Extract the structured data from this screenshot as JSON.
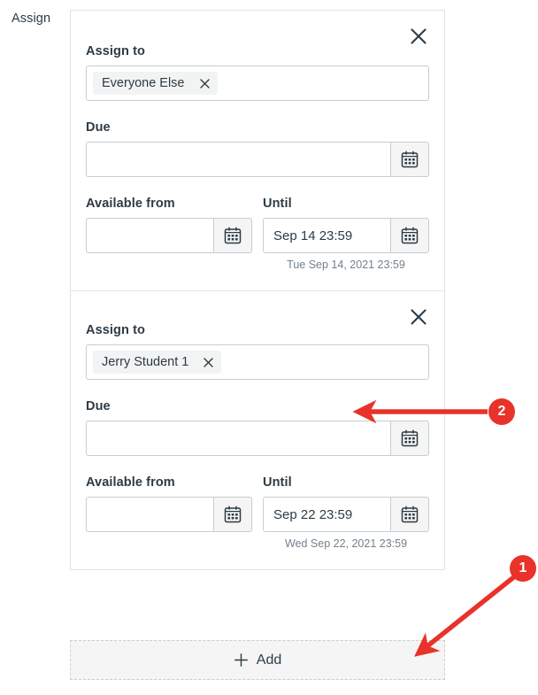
{
  "page": {
    "side_label": "Assign",
    "accent_color": "#e8322a",
    "text_color": "#2d3b45",
    "border_color": "#c7cdd1"
  },
  "assign_cards": [
    {
      "close_icon": "close-icon",
      "assign_to_label": "Assign to",
      "pills": [
        {
          "label": "Everyone Else",
          "remove_icon": "close-icon"
        }
      ],
      "due_label": "Due",
      "due_value": "",
      "due_calendar_icon": "calendar-icon",
      "available_from_label": "Available from",
      "available_from_value": "",
      "available_from_calendar_icon": "calendar-icon",
      "until_label": "Until",
      "until_value": "Sep 14 23:59",
      "until_calendar_icon": "calendar-icon",
      "until_helper": "Tue Sep 14, 2021 23:59"
    },
    {
      "close_icon": "close-icon",
      "assign_to_label": "Assign to",
      "pills": [
        {
          "label": "Jerry Student 1",
          "remove_icon": "close-icon"
        }
      ],
      "due_label": "Due",
      "due_value": "",
      "due_calendar_icon": "calendar-icon",
      "available_from_label": "Available from",
      "available_from_value": "",
      "available_from_calendar_icon": "calendar-icon",
      "until_label": "Until",
      "until_value": "Sep 22 23:59",
      "until_calendar_icon": "calendar-icon",
      "until_helper": "Wed Sep 22, 2021 23:59"
    }
  ],
  "add_button": {
    "label": "Add",
    "icon": "plus-icon"
  },
  "annotations": [
    {
      "id": "1",
      "label": "1"
    },
    {
      "id": "2",
      "label": "2"
    }
  ]
}
